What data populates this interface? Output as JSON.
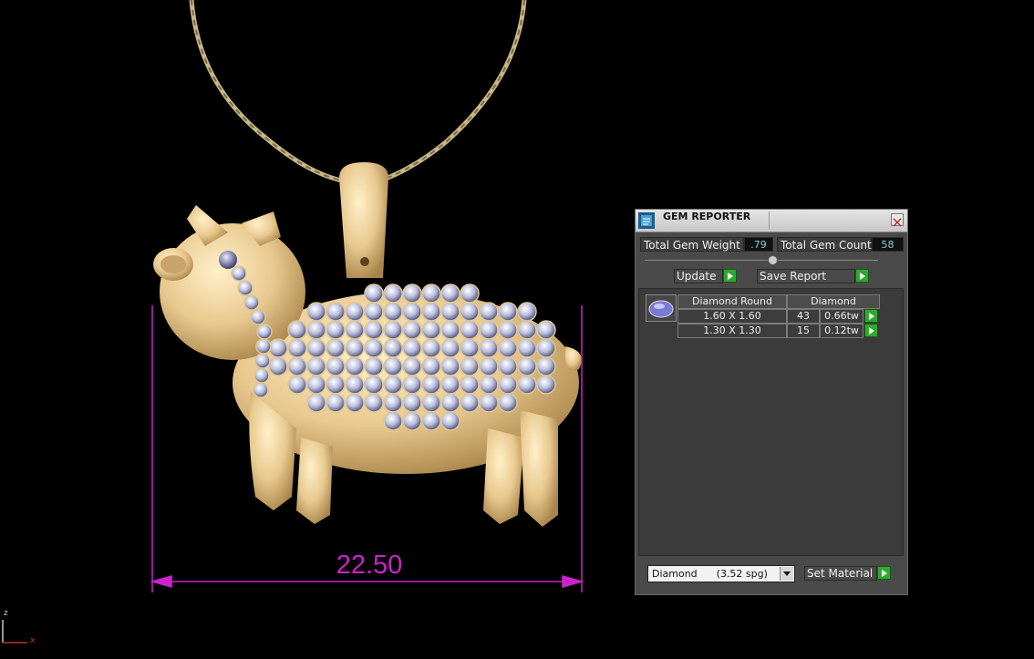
{
  "viewport": {
    "dimension_value": "22.50",
    "axis_z": "z",
    "axis_x": "x",
    "dimension_color": "#cc22cc",
    "model": "pig-pendant-with-chain"
  },
  "gem_reporter": {
    "title": "GEM REPORTER",
    "total_gem_weight_label": "Total Gem Weight",
    "total_gem_weight_value": ".79",
    "total_gem_count_label": "Total Gem Count",
    "total_gem_count_value": "58",
    "update_label": "Update",
    "save_report_label": "Save Report",
    "table": {
      "col_shape": "Diamond Round",
      "col_material": "Diamond",
      "rows": [
        {
          "size": "1.60 X 1.60",
          "count": "43",
          "weight": "0.66tw"
        },
        {
          "size": "1.30 X 1.30",
          "count": "15",
          "weight": "0.12tw"
        }
      ]
    },
    "material_select": "Diamond      (3.52 spg)",
    "set_material_label": "Set Material"
  }
}
